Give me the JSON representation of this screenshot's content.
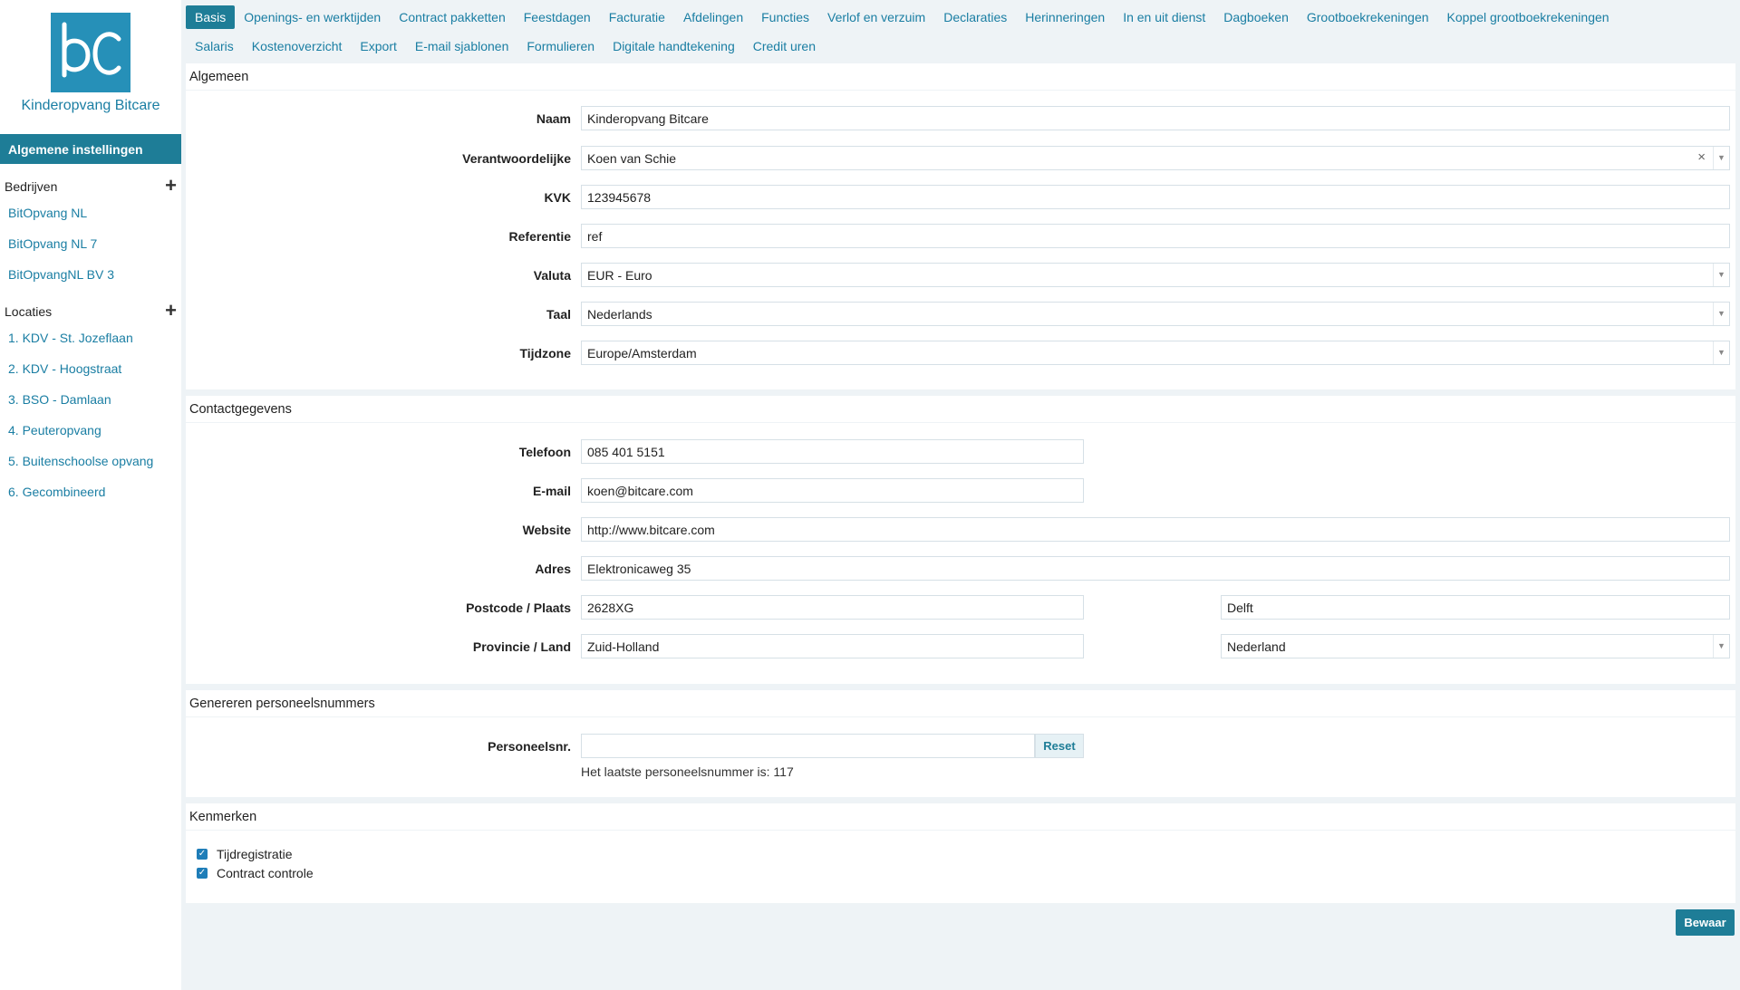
{
  "app": {
    "company_name": "Kinderopvang Bitcare",
    "logo_letters": "bc",
    "brand_color": "#2690b8",
    "accent_color": "#1e7d97"
  },
  "sidebar": {
    "active_item": "Algemene instellingen",
    "companies_header": "Bedrijven",
    "companies": [
      "BitOpvang NL",
      "BitOpvang NL 7",
      "BitOpvangNL BV 3"
    ],
    "locations_header": "Locaties",
    "locations": [
      "1. KDV - St. Jozeflaan",
      "2. KDV - Hoogstraat",
      "3. BSO - Damlaan",
      "4. Peuteropvang",
      "5. Buitenschoolse opvang",
      "6. Gecombineerd"
    ],
    "add_icon": "plus-icon"
  },
  "tabs": {
    "row1": [
      "Basis",
      "Openings- en werktijden",
      "Contract pakketten",
      "Feestdagen",
      "Facturatie",
      "Afdelingen",
      "Functies",
      "Verlof en verzuim",
      "Declaraties",
      "Herinneringen",
      "In en uit dienst",
      "Dagboeken",
      "Grootboekrekeningen",
      "Koppel grootboekrekeningen"
    ],
    "row2": [
      "Salaris",
      "Kostenoverzicht",
      "Export",
      "E-mail sjablonen",
      "Formulieren",
      "Digitale handtekening",
      "Credit uren"
    ],
    "active": "Basis"
  },
  "general": {
    "title": "Algemeen",
    "name_label": "Naam",
    "name_value": "Kinderopvang Bitcare",
    "responsible_label": "Verantwoordelijke",
    "responsible_value": "Koen van Schie",
    "kvk_label": "KVK",
    "kvk_value": "123945678",
    "reference_label": "Referentie",
    "reference_value": "ref",
    "currency_label": "Valuta",
    "currency_value": "EUR - Euro",
    "language_label": "Taal",
    "language_value": "Nederlands",
    "timezone_label": "Tijdzone",
    "timezone_value": "Europe/Amsterdam"
  },
  "contact": {
    "title": "Contactgegevens",
    "phone_label": "Telefoon",
    "phone_value": "085 401 5151",
    "email_label": "E-mail",
    "email_value": "koen@bitcare.com",
    "website_label": "Website",
    "website_value": "http://www.bitcare.com",
    "address_label": "Adres",
    "address_value": "Elektronicaweg 35",
    "postal_label": "Postcode / Plaats",
    "postal_value": "2628XG",
    "city_value": "Delft",
    "province_label": "Provincie / Land",
    "province_value": "Zuid-Holland",
    "country_value": "Nederland"
  },
  "personnel": {
    "title": "Genereren personeelsnummers",
    "label": "Personeelsnr.",
    "value": "",
    "reset_label": "Reset",
    "hint": "Het laatste personeelsnummer is: 117"
  },
  "features": {
    "title": "Kenmerken",
    "items": [
      {
        "label": "Tijdregistratie",
        "checked": true
      },
      {
        "label": "Contract controle",
        "checked": true
      }
    ]
  },
  "save_label": "Bewaar"
}
